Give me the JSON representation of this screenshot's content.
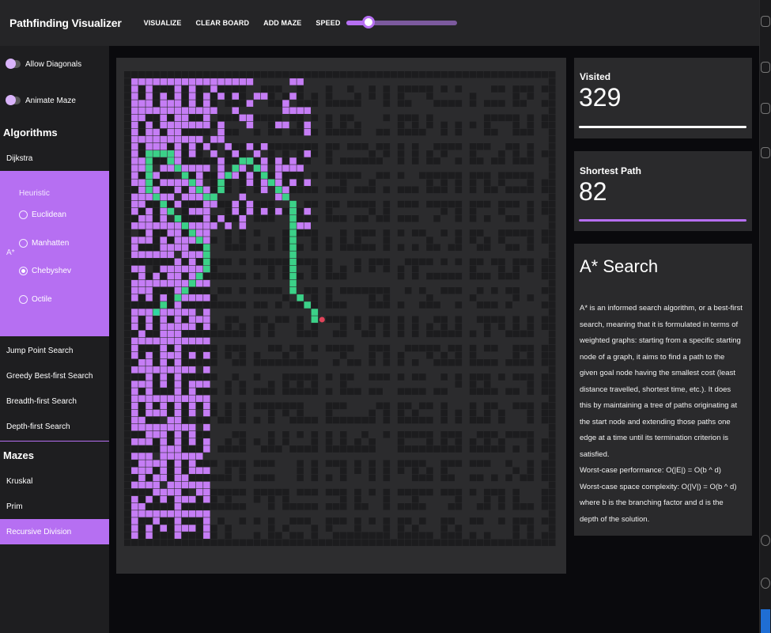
{
  "header": {
    "title": "Pathfinding Visualizer",
    "nav": [
      "VISUALIZE",
      "CLEAR BOARD",
      "ADD MAZE",
      "SPEED"
    ],
    "speed_value": 0.2
  },
  "sidebar": {
    "toggles": [
      "Allow Diagonals",
      "Animate Maze"
    ],
    "algorithms_title": "Algorithms",
    "dijkstra": "Dijkstra",
    "astar_label": "A*",
    "heuristic_title": "Heuristic",
    "heuristics": [
      "Euclidean",
      "Manhatten",
      "Chebyshev",
      "Octile"
    ],
    "selected_heuristic": "Chebyshev",
    "other_algorithms": [
      "Jump Point Search",
      "Greedy Best-first Search",
      "Breadth-first Search",
      "Depth-first Search"
    ],
    "mazes_title": "Mazes",
    "mazes": [
      "Kruskal",
      "Prim",
      "Recursive Division"
    ],
    "selected_maze": "Recursive Division"
  },
  "stats": {
    "visited_label": "Visited",
    "visited_value": "329",
    "shortest_label": "Shortest Path",
    "shortest_value": "82"
  },
  "description": {
    "title": "A* Search",
    "body": "A* is an informed search algorithm, or a best-first search, meaning that it is formulated in terms of weighted graphs: starting from a specific starting node of a graph, it aims to find a path to the given goal node having the smallest cost (least distance travelled, shortest time, etc.). It does this by maintaining a tree of paths originating at the start node and extending those paths one edge at a time until its termination criterion is satisfied.",
    "worst_time": "Worst-case performance: O(|E|) = O(b ^ d)",
    "worst_space": "Worst-case space complexity: O(|V|) = O(b ^ d)",
    "footer": "where b is the branching factor and d is the depth of the solution."
  },
  "colors": {
    "accent": "#b66ff2",
    "visited": "#c57df5",
    "path": "#3bd188",
    "wall": "#1c1c1e",
    "open": "#2b2b2d"
  }
}
